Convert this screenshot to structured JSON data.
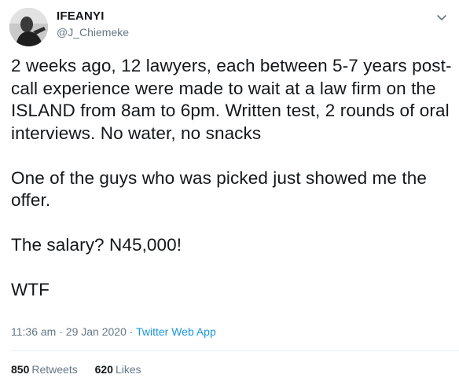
{
  "user": {
    "display_name": "IFEANYI",
    "handle": "@J_Chiemeke",
    "avatar_icon": "profile-photo"
  },
  "menu": {
    "icon": "chevron-down-icon"
  },
  "tweet": {
    "text": "2 weeks ago, 12 lawyers, each between 5-7 years post-call experience were made to wait at a law firm on the ISLAND from 8am to 6pm. Written test, 2 rounds of oral interviews. No water, no snacks\n\nOne of the guys who was picked just showed me the offer.\n\nThe salary? N45,000!\n\nWTF",
    "time": "11:36 am",
    "separator": "·",
    "date": "29 Jan 2020",
    "source": "Twitter Web App"
  },
  "stats": {
    "retweets_count": "850",
    "retweets_label": "Retweets",
    "likes_count": "620",
    "likes_label": "Likes"
  },
  "colors": {
    "text": "#14171a",
    "secondary": "#657786",
    "link": "#1b95e0",
    "divider": "#e6ecf0"
  }
}
